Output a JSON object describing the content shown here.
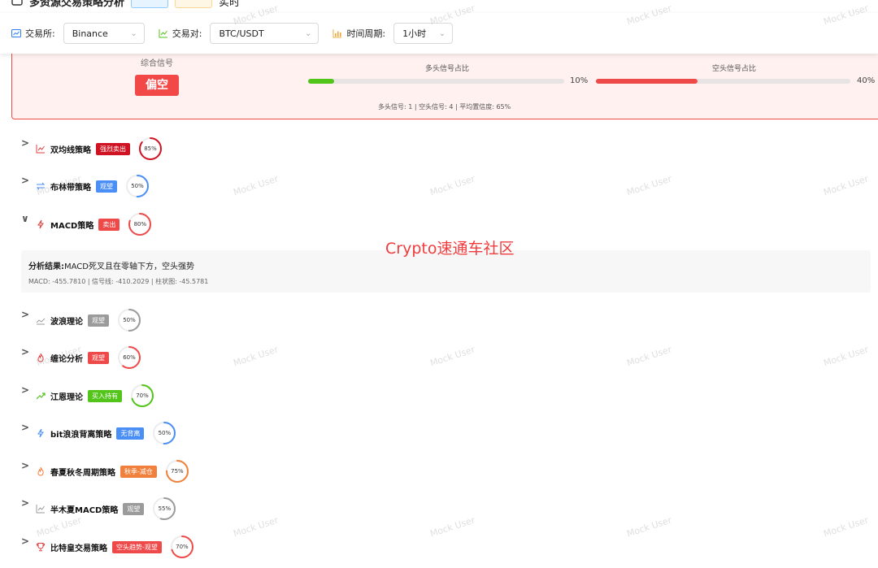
{
  "header": {
    "title_partial": "多资源交易策略分析",
    "trailing_text": "实时"
  },
  "filters": {
    "exchange": {
      "label": "交易所:",
      "value": "Binance",
      "icon": "bar-chart-square-icon"
    },
    "pair": {
      "label": "交易对:",
      "value": "BTC/USDT",
      "icon": "line-chart-icon"
    },
    "period": {
      "label": "时间周期:",
      "value": "1小时",
      "icon": "bar-chart-icon"
    }
  },
  "summary": {
    "label": "综合信号",
    "signal": "偏空",
    "long_title": "多头信号占比",
    "long_pct_text": "10%",
    "long_ratio": 0.1,
    "short_title": "空头信号占比",
    "short_pct_text": "40%",
    "short_ratio": 0.4,
    "detail": "多头信号: 1 | 空头信号: 4 | 平均置信度: 65%",
    "colors": {
      "long": "#52c41a",
      "short": "#ef4a4a",
      "badge": "#f24848"
    }
  },
  "strategies": [
    {
      "name": "双均线策略",
      "tag": "强烈卖出",
      "tag_color": "#cf1322",
      "confidence_text": "85%",
      "confidence": 0.85,
      "ring_color": "#cf1322",
      "icon": "line-chart-icon",
      "icon_color": "#e03c3c",
      "expanded": false
    },
    {
      "name": "布林带策略",
      "tag": "观望",
      "tag_color": "#4a8ff5",
      "confidence_text": "50%",
      "confidence": 0.5,
      "ring_color": "#4a8ff5",
      "icon": "swap-arrows-icon",
      "icon_color": "#4a8ff5",
      "expanded": false
    },
    {
      "name": "MACD策略",
      "tag": "卖出",
      "tag_color": "#ef4a4a",
      "confidence_text": "80%",
      "confidence": 0.8,
      "ring_color": "#ef4a4a",
      "icon": "lightning-icon",
      "icon_color": "#e03c3c",
      "expanded": true
    },
    {
      "name": "波浪理论",
      "tag": "观望",
      "tag_color": "#9b9b9b",
      "confidence_text": "50%",
      "confidence": 0.5,
      "ring_color": "#9b9b9b",
      "icon": "area-chart-icon",
      "icon_color": "#9b9b9b",
      "expanded": false
    },
    {
      "name": "缠论分析",
      "tag": "观望",
      "tag_color": "#ef4a4a",
      "confidence_text": "60%",
      "confidence": 0.6,
      "ring_color": "#ef4a4a",
      "icon": "fire-icon",
      "icon_color": "#e03c3c",
      "expanded": false
    },
    {
      "name": "江恩理论",
      "tag": "买入持有",
      "tag_color": "#52c41a",
      "confidence_text": "70%",
      "confidence": 0.7,
      "ring_color": "#52c41a",
      "icon": "trend-up-icon",
      "icon_color": "#52c41a",
      "expanded": false
    },
    {
      "name": "bit浪浪背离策略",
      "tag": "无背离",
      "tag_color": "#4a8ff5",
      "confidence_text": "50%",
      "confidence": 0.5,
      "ring_color": "#4a8ff5",
      "icon": "lightning-icon",
      "icon_color": "#4a8ff5",
      "expanded": false
    },
    {
      "name": "春夏秋冬周期策略",
      "tag": "秋季-减仓",
      "tag_color": "#f0803c",
      "confidence_text": "75%",
      "confidence": 0.75,
      "ring_color": "#f0803c",
      "icon": "fire-icon",
      "icon_color": "#f0803c",
      "expanded": false
    },
    {
      "name": "半木夏MACD策略",
      "tag": "观望",
      "tag_color": "#9b9b9b",
      "confidence_text": "55%",
      "confidence": 0.55,
      "ring_color": "#9b9b9b",
      "icon": "line-chart-icon",
      "icon_color": "#9b9b9b",
      "expanded": false
    },
    {
      "name": "比特皇交易策略",
      "tag": "空头趋势-观望",
      "tag_color": "#ef4a4a",
      "confidence_text": "70%",
      "confidence": 0.7,
      "ring_color": "#ef4a4a",
      "icon": "trophy-icon",
      "icon_color": "#e03c3c",
      "expanded": false
    }
  ],
  "macd_detail": {
    "result_label": "分析结果:",
    "result_text": "MACD死叉且在零轴下方，空头强势",
    "values": "MACD: -455.7810 | 信号线: -410.2029 | 柱状图: -45.5781"
  },
  "watermark": {
    "text": "Mock User",
    "overlay": "Crypto速通车社区"
  }
}
